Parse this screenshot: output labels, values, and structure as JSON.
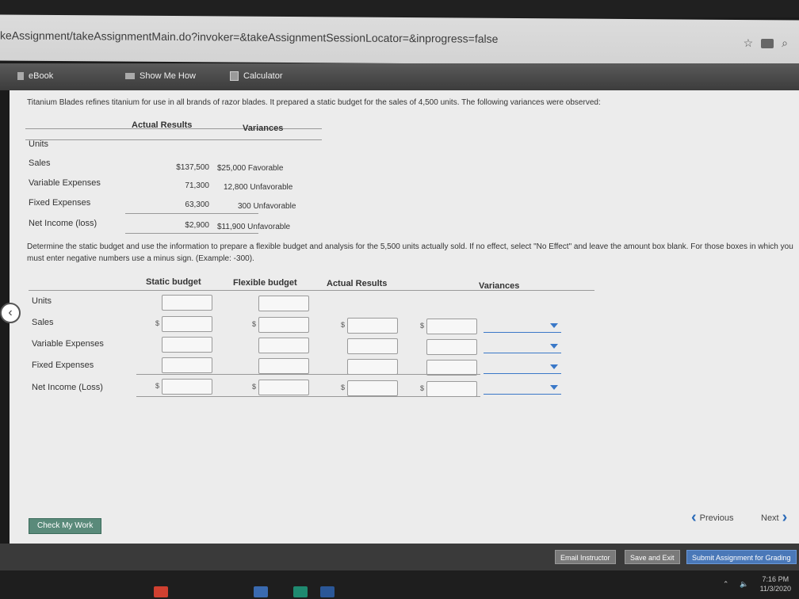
{
  "browser": {
    "url": "keAssignment/takeAssignmentMain.do?invoker=&takeAssignmentSessionLocator=&inprogress=false"
  },
  "toolbar": {
    "ebook": "eBook",
    "show_me_how": "Show Me How",
    "calculator": "Calculator"
  },
  "problem": {
    "intro": "Titanium Blades refines titanium for use in all brands of razor blades. It prepared a static budget for the sales of 4,500 units. The following variances were observed:",
    "given": {
      "headers": [
        "Actual Results",
        "Variances"
      ],
      "rows": [
        {
          "label": "Units",
          "actual": "",
          "variance": ""
        },
        {
          "label": "Sales",
          "actual": "$137,500",
          "variance": "$25,000 Favorable"
        },
        {
          "label": "Variable Expenses",
          "actual": "71,300",
          "variance": "12,800 Unfavorable"
        },
        {
          "label": "Fixed Expenses",
          "actual": "63,300",
          "variance": "300 Unfavorable"
        },
        {
          "label": "Net Income (loss)",
          "actual": "$2,900",
          "variance": "$11,900 Unfavorable"
        }
      ]
    },
    "instructions": "Determine the static budget and use the information to prepare a flexible budget and analysis for the 5,500 units actually sold. If no effect, select \"No Effect\" and leave the amount box blank. For those boxes in which you must enter negative numbers use a minus sign. (Example: -300).",
    "answer": {
      "headers": [
        "Static budget",
        "Flexible budget",
        "Actual Results",
        "Variances"
      ],
      "rows": [
        "Units",
        "Sales",
        "Variable Expenses",
        "Fixed Expenses",
        "Net Income (Loss)"
      ],
      "currency_symbol": "$"
    }
  },
  "buttons": {
    "check_my_work": "Check My Work",
    "previous": "Previous",
    "next": "Next",
    "email_instructor": "Email Instructor",
    "save_and_exit": "Save and Exit",
    "submit": "Submit Assignment for Grading"
  },
  "taskbar": {
    "time": "7:16 PM",
    "date": "11/3/2020"
  },
  "colors": {
    "accent": "#3a78c8",
    "toolbar": "#4a4a4a",
    "check_button": "#5a8a7a"
  }
}
